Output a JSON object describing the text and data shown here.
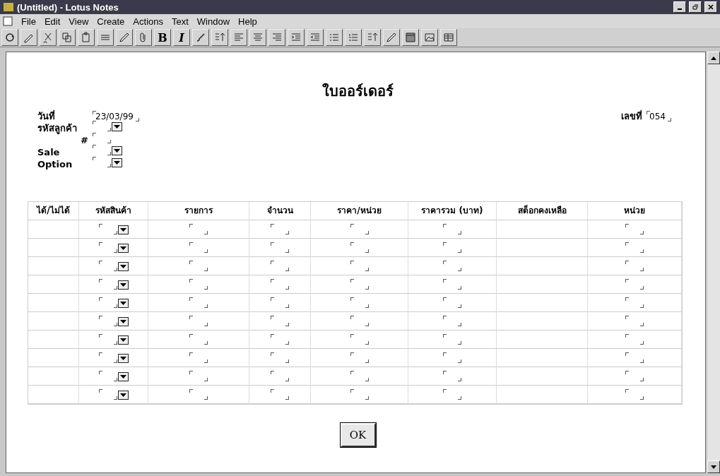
{
  "window": {
    "title": "(Untitled) - Lotus Notes"
  },
  "menu": [
    "File",
    "Edit",
    "View",
    "Create",
    "Actions",
    "Text",
    "Window",
    "Help"
  ],
  "toolbar": [
    {
      "kind": "refresh"
    },
    {
      "kind": "edit"
    },
    {
      "kind": "cut"
    },
    {
      "kind": "copy"
    },
    {
      "kind": "paste"
    },
    {
      "kind": "lines"
    },
    {
      "kind": "pen"
    },
    {
      "kind": "clip"
    },
    {
      "kind": "glyph",
      "label": "B"
    },
    {
      "kind": "italic",
      "label": "I"
    },
    {
      "kind": "brush"
    },
    {
      "kind": "style"
    },
    {
      "kind": "alignleft"
    },
    {
      "kind": "aligncenter"
    },
    {
      "kind": "alignright"
    },
    {
      "kind": "indent"
    },
    {
      "kind": "outdent"
    },
    {
      "kind": "bullets"
    },
    {
      "kind": "numbers"
    },
    {
      "kind": "style"
    },
    {
      "kind": "pen"
    },
    {
      "kind": "book"
    },
    {
      "kind": "picture"
    },
    {
      "kind": "table"
    }
  ],
  "form": {
    "title": "ใบออร์เดอร์",
    "fields": [
      {
        "label": "วันที่",
        "kind": "text",
        "value": "23/03/99"
      },
      {
        "label": "รหัสลูกค้า",
        "kind": "dropdown"
      },
      {
        "label": "#",
        "kind": "subtext"
      },
      {
        "label": "Sale",
        "kind": "dropdown"
      },
      {
        "label": "Option",
        "kind": "dropdown"
      }
    ],
    "number": {
      "label": "เลขที่",
      "value": "054"
    },
    "table": {
      "columns": [
        "ได้/ไม่ได้",
        "รหัสสินค้า",
        "รายการ",
        "จำนวน",
        "ราคา/หน่วย",
        "ราคารวม (บาท)",
        "สต็อกคงเหลือ",
        "หน่วย"
      ],
      "rows": [
        {
          "cells": [
            {
              "kind": "empty"
            },
            {
              "kind": "dropdown"
            },
            {
              "kind": "text"
            },
            {
              "kind": "text"
            },
            {
              "kind": "text"
            },
            {
              "kind": "text"
            },
            {
              "kind": "empty"
            },
            {
              "kind": "text"
            }
          ]
        },
        {
          "cells": [
            {
              "kind": "empty"
            },
            {
              "kind": "dropdown"
            },
            {
              "kind": "text"
            },
            {
              "kind": "text"
            },
            {
              "kind": "text"
            },
            {
              "kind": "text"
            },
            {
              "kind": "empty"
            },
            {
              "kind": "text"
            }
          ]
        },
        {
          "cells": [
            {
              "kind": "empty"
            },
            {
              "kind": "dropdown"
            },
            {
              "kind": "text"
            },
            {
              "kind": "text"
            },
            {
              "kind": "text"
            },
            {
              "kind": "text"
            },
            {
              "kind": "empty"
            },
            {
              "kind": "text"
            }
          ]
        },
        {
          "cells": [
            {
              "kind": "empty"
            },
            {
              "kind": "dropdown"
            },
            {
              "kind": "text"
            },
            {
              "kind": "text"
            },
            {
              "kind": "text"
            },
            {
              "kind": "text"
            },
            {
              "kind": "empty"
            },
            {
              "kind": "text"
            }
          ]
        },
        {
          "cells": [
            {
              "kind": "empty"
            },
            {
              "kind": "dropdown"
            },
            {
              "kind": "text"
            },
            {
              "kind": "text"
            },
            {
              "kind": "text"
            },
            {
              "kind": "text"
            },
            {
              "kind": "empty"
            },
            {
              "kind": "text"
            }
          ]
        },
        {
          "cells": [
            {
              "kind": "empty"
            },
            {
              "kind": "dropdown"
            },
            {
              "kind": "text"
            },
            {
              "kind": "text"
            },
            {
              "kind": "text"
            },
            {
              "kind": "text"
            },
            {
              "kind": "empty"
            },
            {
              "kind": "text"
            }
          ]
        },
        {
          "cells": [
            {
              "kind": "empty"
            },
            {
              "kind": "dropdown"
            },
            {
              "kind": "text"
            },
            {
              "kind": "text"
            },
            {
              "kind": "text"
            },
            {
              "kind": "text"
            },
            {
              "kind": "empty"
            },
            {
              "kind": "text"
            }
          ]
        },
        {
          "cells": [
            {
              "kind": "empty"
            },
            {
              "kind": "dropdown"
            },
            {
              "kind": "text"
            },
            {
              "kind": "text"
            },
            {
              "kind": "text"
            },
            {
              "kind": "text"
            },
            {
              "kind": "empty"
            },
            {
              "kind": "text"
            }
          ]
        },
        {
          "cells": [
            {
              "kind": "empty"
            },
            {
              "kind": "dropdown"
            },
            {
              "kind": "text"
            },
            {
              "kind": "text"
            },
            {
              "kind": "text"
            },
            {
              "kind": "text"
            },
            {
              "kind": "empty"
            },
            {
              "kind": "text"
            }
          ]
        },
        {
          "cells": [
            {
              "kind": "empty"
            },
            {
              "kind": "dropdown"
            },
            {
              "kind": "text"
            },
            {
              "kind": "text"
            },
            {
              "kind": "text"
            },
            {
              "kind": "text"
            },
            {
              "kind": "empty"
            },
            {
              "kind": "text"
            }
          ]
        }
      ]
    },
    "button": "OK"
  }
}
